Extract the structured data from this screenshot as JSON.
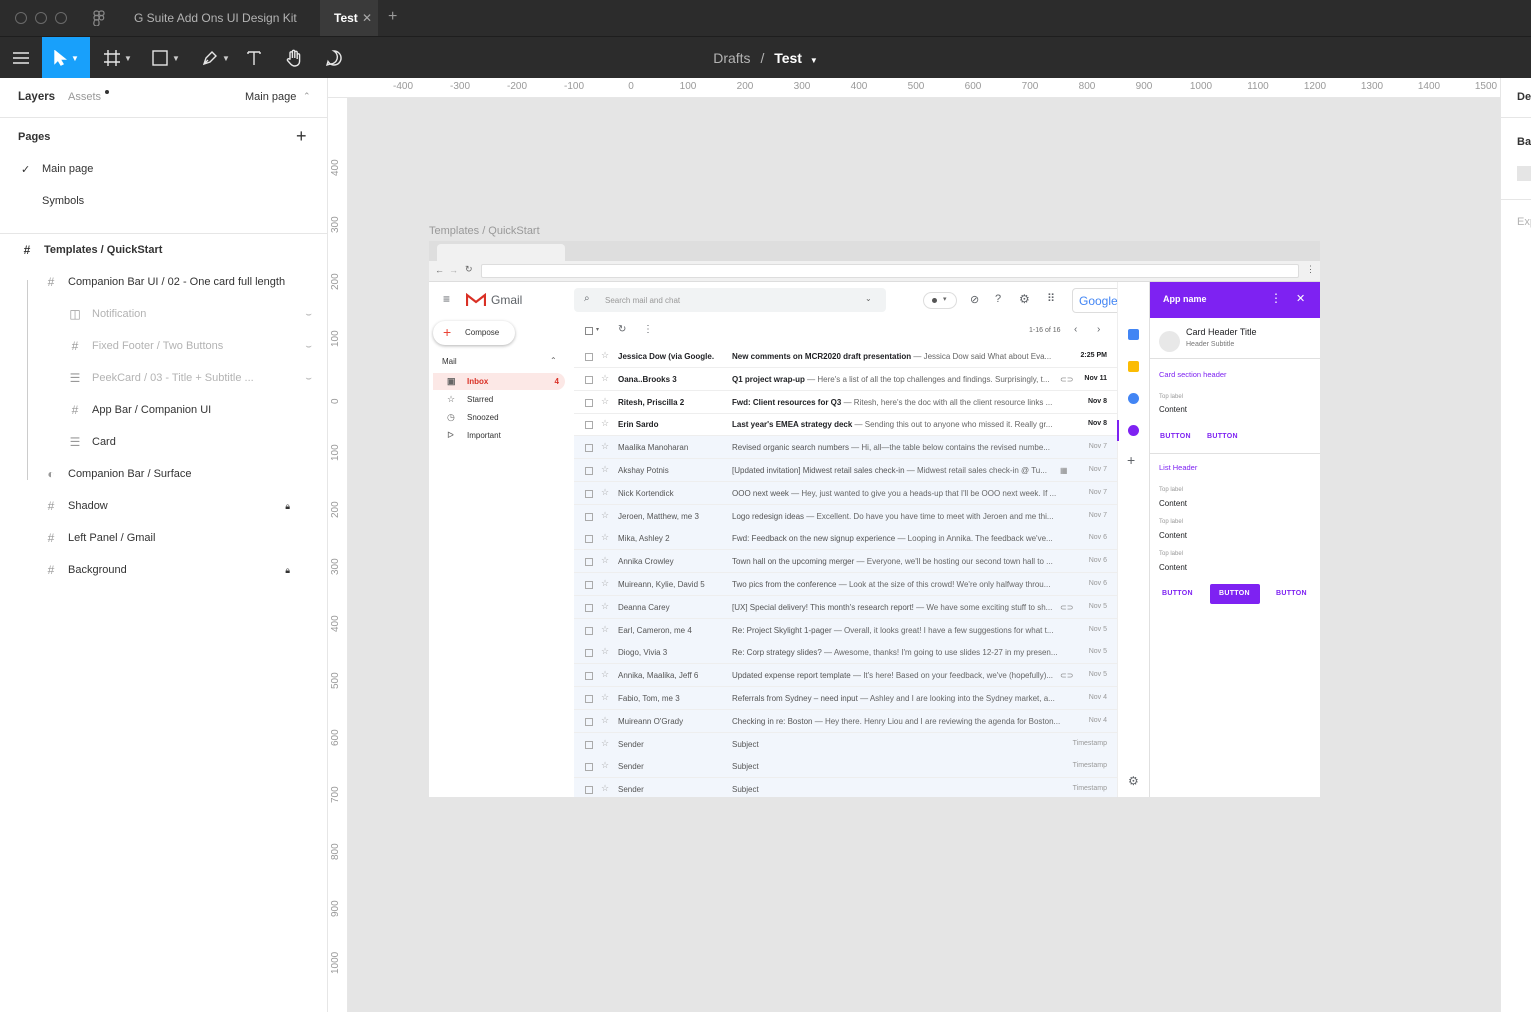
{
  "window": {
    "tabs": [
      {
        "label": "G Suite Add Ons UI Design Kit"
      },
      {
        "label": "Test"
      }
    ]
  },
  "toolbar": {
    "breadcrumb_parent": "Drafts",
    "breadcrumb_sep": "/",
    "breadcrumb_current": "Test"
  },
  "left_panel": {
    "tab_layers": "Layers",
    "tab_assets": "Assets",
    "page_selector": "Main page",
    "pages_title": "Pages",
    "pages": [
      {
        "label": "Main page",
        "selected": true
      },
      {
        "label": "Symbols",
        "selected": false
      }
    ],
    "layers": [
      {
        "label": "Templates / QuickStart"
      },
      {
        "label": "Companion Bar UI / 02 - One card full length"
      },
      {
        "label": "Notification"
      },
      {
        "label": "Fixed Footer / Two Buttons"
      },
      {
        "label": "PeekCard / 03 - Title + Subtitle ..."
      },
      {
        "label": "App Bar / Companion UI"
      },
      {
        "label": "Card"
      },
      {
        "label": "Companion Bar / Surface"
      },
      {
        "label": "Shadow"
      },
      {
        "label": "Left Panel / Gmail"
      },
      {
        "label": "Background"
      }
    ]
  },
  "rulers": {
    "top": [
      "-400",
      "-300",
      "-200",
      "-100",
      "0",
      "100",
      "200",
      "300",
      "400",
      "500",
      "600",
      "700",
      "800",
      "900",
      "1000",
      "1100",
      "1200",
      "1300",
      "1400",
      "1500"
    ],
    "left": [
      "400",
      "300",
      "200",
      "100",
      "0",
      "100",
      "200",
      "300",
      "400",
      "500",
      "600",
      "700",
      "800",
      "900",
      "1000"
    ]
  },
  "right_panel": {
    "design_tab": "De",
    "background_label": "Bac",
    "export_label": "Exp"
  },
  "canvas": {
    "frame_label": "Templates / QuickStart",
    "gmail": {
      "brand": "Gmail",
      "search_placeholder": "Search mail and chat",
      "compose": "Compose",
      "mail_header": "Mail",
      "google_logo": "Google",
      "pagination": "1-16 of 16",
      "nav": [
        {
          "label": "Inbox",
          "count": "4"
        },
        {
          "label": "Starred"
        },
        {
          "label": "Snoozed"
        },
        {
          "label": "Important"
        }
      ],
      "emails": [
        {
          "sender": "Jessica Dow (via Google.",
          "subject": "New comments on MCR2020 draft presentation",
          "snippet": " — Jessica Dow said What about Eva...",
          "date": "2:25 PM",
          "unread": true
        },
        {
          "sender": "Oana..Brooks 3",
          "subject": "Q1 project wrap-up",
          "snippet": " — Here's a list of all the top challenges and findings. Surprisingly, t...",
          "date": "Nov 11",
          "unread": true
        },
        {
          "sender": "Ritesh, Priscilla 2",
          "subject": "Fwd: Client resources for Q3",
          "snippet": " — Ritesh, here's the doc with all the client resource links ...",
          "date": "Nov 8",
          "unread": true
        },
        {
          "sender": "Erin Sardo",
          "subject": "Last year's EMEA strategy deck",
          "snippet": " — Sending this out to anyone who missed it. Really gr...",
          "date": "Nov 8",
          "unread": true
        },
        {
          "sender": "Maalika Manoharan",
          "subject": "Revised organic search numbers",
          "snippet": " — Hi, all—the table below contains the revised numbe...",
          "date": "Nov 7",
          "unread": false
        },
        {
          "sender": "Akshay Potnis",
          "subject": "[Updated invitation] Midwest retail sales check-in",
          "snippet": " — Midwest retail sales check-in @ Tu...",
          "date": "Nov 7",
          "unread": false
        },
        {
          "sender": "Nick Kortendick",
          "subject": "OOO next week",
          "snippet": " — Hey, just wanted to give you a heads-up that I'll be OOO next week. If ...",
          "date": "Nov 7",
          "unread": false
        },
        {
          "sender": "Jeroen, Matthew, me 3",
          "subject": "Logo redesign ideas",
          "snippet": " — Excellent. Do have you have time to meet with Jeroen and me thi...",
          "date": "Nov 7",
          "unread": false
        },
        {
          "sender": "Mika, Ashley 2",
          "subject": "Fwd: Feedback on the new signup experience",
          "snippet": " — Looping in Annika. The feedback we've...",
          "date": "Nov 6",
          "unread": false
        },
        {
          "sender": "Annika Crowley",
          "subject": "Town hall on the upcoming merger",
          "snippet": " — Everyone, we'll be hosting our second town hall to ...",
          "date": "Nov 6",
          "unread": false
        },
        {
          "sender": "Muireann, Kylie, David 5",
          "subject": "Two pics from the conference",
          "snippet": " — Look at the size of this crowd! We're only halfway throu...",
          "date": "Nov 6",
          "unread": false
        },
        {
          "sender": "Deanna Carey",
          "subject": "[UX] Special delivery! This month's research report!",
          "snippet": " — We have some exciting stuff to sh...",
          "date": "Nov 5",
          "unread": false
        },
        {
          "sender": "Earl, Cameron, me 4",
          "subject": "Re: Project Skylight 1-pager",
          "snippet": " — Overall, it looks great! I have a few suggestions for what t...",
          "date": "Nov 5",
          "unread": false
        },
        {
          "sender": "Diogo, Vivia 3",
          "subject": "Re: Corp strategy slides?",
          "snippet": " — Awesome, thanks! I'm going to use slides 12-27 in my presen...",
          "date": "Nov 5",
          "unread": false
        },
        {
          "sender": "Annika, Maalika, Jeff 6",
          "subject": "Updated expense report template",
          "snippet": " — It's here! Based on your feedback, we've (hopefully)...",
          "date": "Nov 5",
          "unread": false
        },
        {
          "sender": "Fabio, Tom, me 3",
          "subject": "Referrals from Sydney – need input",
          "snippet": " — Ashley and I are looking into the Sydney market, a...",
          "date": "Nov 4",
          "unread": false
        },
        {
          "sender": "Muireann O'Grady",
          "subject": "Checking in re: Boston",
          "snippet": " — Hey there. Henry Liou and I are reviewing the agenda for Boston...",
          "date": "Nov 4",
          "unread": false
        },
        {
          "sender": "Sender",
          "subject": "Subject",
          "snippet": "",
          "date": "Timestamp",
          "unread": false
        },
        {
          "sender": "Sender",
          "subject": "Subject",
          "snippet": "",
          "date": "Timestamp",
          "unread": false
        },
        {
          "sender": "Sender",
          "subject": "Subject",
          "snippet": "",
          "date": "Timestamp",
          "unread": false
        }
      ]
    },
    "companion": {
      "app_name": "App name",
      "card_title": "Card Header Title",
      "card_subtitle": "Header Subtitle",
      "section_header": "Card section header",
      "top_label": "Top label",
      "content": "Content",
      "button": "BUTTON",
      "list_header": "List Header"
    },
    "accent": "#7e22f2"
  }
}
